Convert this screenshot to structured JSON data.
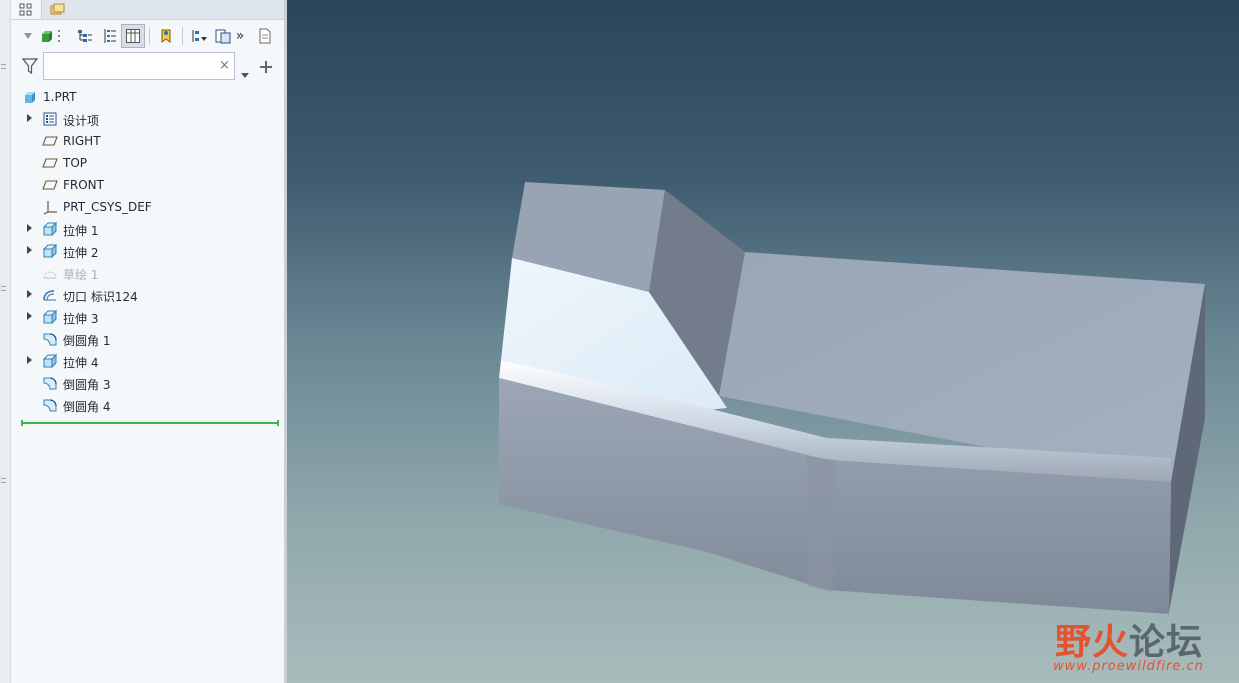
{
  "model_tree": {
    "search": {
      "value": "",
      "clear_icon": "×"
    },
    "items": [
      {
        "label": "1.PRT",
        "icon": "part-icon",
        "expandable": false
      },
      {
        "label": "设计项",
        "icon": "design-items-icon",
        "expandable": true
      },
      {
        "label": "RIGHT",
        "icon": "datum-plane-icon",
        "expandable": false
      },
      {
        "label": "TOP",
        "icon": "datum-plane-icon",
        "expandable": false
      },
      {
        "label": "FRONT",
        "icon": "datum-plane-icon",
        "expandable": false
      },
      {
        "label": "PRT_CSYS_DEF",
        "icon": "coordinate-system-icon",
        "expandable": false
      },
      {
        "label": "拉伸 1",
        "icon": "extrude-icon",
        "expandable": true
      },
      {
        "label": "拉伸 2",
        "icon": "extrude-icon",
        "expandable": true
      },
      {
        "label": "草绘 1",
        "icon": "sketch-icon",
        "expandable": false,
        "dim": true
      },
      {
        "label": "切口 标识124",
        "icon": "cut-icon",
        "expandable": true
      },
      {
        "label": "拉伸 3",
        "icon": "extrude-icon",
        "expandable": true
      },
      {
        "label": "倒圆角 1",
        "icon": "round-icon",
        "expandable": false
      },
      {
        "label": "拉伸 4",
        "icon": "extrude-icon",
        "expandable": true
      },
      {
        "label": "倒圆角 3",
        "icon": "round-icon",
        "expandable": false
      },
      {
        "label": "倒圆角 4",
        "icon": "round-icon",
        "expandable": false
      }
    ]
  },
  "toolbar": {
    "more_label": "»"
  },
  "watermark": {
    "chinese_a": "野火",
    "chinese_b": "论坛",
    "url": "www.proewildfire.cn"
  },
  "colors": {
    "viewport_top": "#2b4559",
    "viewport_bottom": "#a9bcbc",
    "accent_green": "#3cb84a",
    "watermark_red": "#e2532f"
  }
}
